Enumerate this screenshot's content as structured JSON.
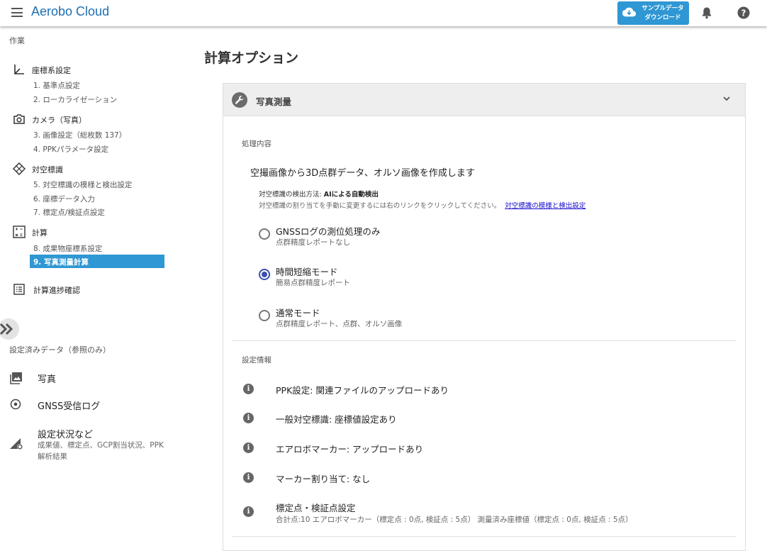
{
  "app": {
    "title": "Aerobo Cloud",
    "download_label_line1": "サンプルデータ",
    "download_label_line2": "ダウンロード",
    "accent": "#2f97d3",
    "brand_color": "#1e6fb0"
  },
  "sidebar": {
    "work_heading": "作業",
    "groups": [
      {
        "label": "座標系設定",
        "icon": "axis-icon",
        "items": [
          "1. 基準点設定",
          "2. ローカライゼーション"
        ]
      },
      {
        "label": "カメラ（写真）",
        "icon": "camera-icon",
        "items": [
          "3. 画像設定（総枚数 137）",
          "4. PPKパラメータ設定"
        ]
      },
      {
        "label": "対空標識",
        "icon": "target-icon",
        "items": [
          "5. 対空標識の模様と検出設定",
          "6. 座標データ入力",
          "7. 標定点/検証点設定"
        ]
      },
      {
        "label": "計算",
        "icon": "calculator-icon",
        "items": [
          "8. 成果物座標系設定",
          "9. 写真測量計算"
        ]
      }
    ],
    "progress_label": "計算進捗確認",
    "reference_heading": "設定済みデータ（参照のみ）",
    "reference_items": [
      {
        "label": "写真",
        "icon": "photo-icon"
      },
      {
        "label": "GNSS受信ログ",
        "icon": "gnss-icon"
      },
      {
        "label": "設定状況など",
        "icon": "settings-status-icon",
        "desc": "成果値、標定点、GCP割当状況、PPK解析結果"
      }
    ]
  },
  "main": {
    "title": "計算オプション",
    "panel_title": "写真測量",
    "processing_heading": "処理内容",
    "processing_desc": "空撮画像から3D点群データ、オルソ画像を作成します",
    "detection_method_prefix": "対空標識の検出方法: ",
    "detection_method_value": "AIによる自動検出",
    "detection_note": "対空標識の割り当てを手動に変更するには右のリンクをクリックしてください。",
    "detection_link": "対空標識の模様と検出設定",
    "options": [
      {
        "label": "GNSSログの測位処理のみ",
        "sub": "点群精度レポートなし",
        "selected": false
      },
      {
        "label": "時間短縮モード",
        "sub": "簡易点群精度レポート",
        "selected": true
      },
      {
        "label": "通常モード",
        "sub": "点群精度レポート、点群、オルソ画像",
        "selected": false
      }
    ],
    "settings_heading": "設定情報",
    "settings": [
      {
        "label": "PPK設定: 関連ファイルのアップロードあり"
      },
      {
        "label": "一般対空標識: 座標値設定あり"
      },
      {
        "label": "エアロボマーカー: アップロードあり"
      },
      {
        "label": "マーカー割り当て: なし"
      },
      {
        "label": "標定点・検証点設定",
        "sub": "合計点:10 エアロボマーカー（標定点 : 0点, 検証点 : 5点） 測量済み座標値（標定点 : 0点, 検証点 : 5点）"
      }
    ]
  }
}
